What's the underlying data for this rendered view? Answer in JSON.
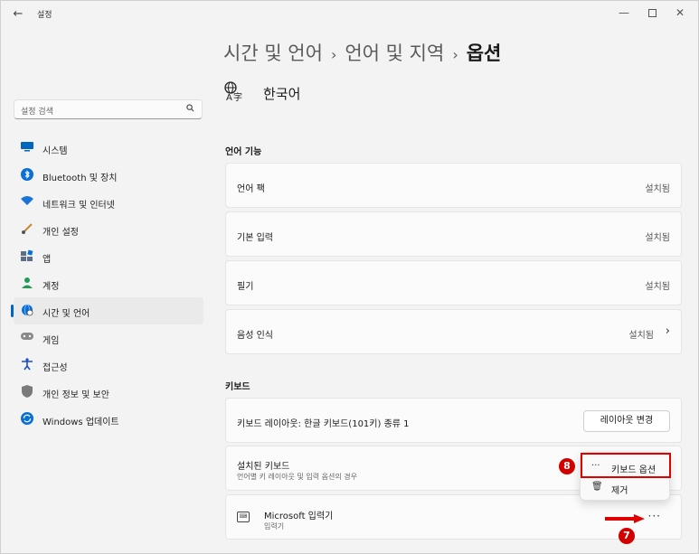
{
  "window": {
    "title": "설정",
    "back_glyph": "←",
    "min_glyph": "—",
    "close_glyph": "✕"
  },
  "search": {
    "placeholder": "설정 검색",
    "icon": "search-icon"
  },
  "nav": {
    "items": [
      {
        "label": "시스템",
        "icon": "monitor-icon",
        "color": "#0067c0"
      },
      {
        "label": "Bluetooth 및 장치",
        "icon": "bluetooth-icon",
        "color": "#0a6fd6"
      },
      {
        "label": "네트워크 및 인터넷",
        "icon": "wifi-icon",
        "color": "#1a73d6"
      },
      {
        "label": "개인 설정",
        "icon": "brush-icon",
        "color": "#c28a2e"
      },
      {
        "label": "앱",
        "icon": "apps-icon",
        "color": "#5c6f86"
      },
      {
        "label": "계정",
        "icon": "account-icon",
        "color": "#1f9d55"
      },
      {
        "label": "시간 및 언어",
        "icon": "globe-clock-icon",
        "color": "#0a6fd6"
      },
      {
        "label": "게임",
        "icon": "gamepad-icon",
        "color": "#777777"
      },
      {
        "label": "접근성",
        "icon": "accessibility-icon",
        "color": "#1a4fc7"
      },
      {
        "label": "개인 정보 및 보안",
        "icon": "shield-icon",
        "color": "#6b6b6b"
      },
      {
        "label": "Windows 업데이트",
        "icon": "update-icon",
        "color": "#0a6fd6"
      }
    ],
    "active_index": 6
  },
  "breadcrumb": {
    "part1": "시간 및 언어",
    "part2": "언어 및 지역",
    "current": "옵션",
    "sep": "›"
  },
  "language": {
    "name": "한국어",
    "icon": "language-icon"
  },
  "sections": {
    "features_title": "언어 기능",
    "keyboard_title": "키보드"
  },
  "features": [
    {
      "label": "언어 팩",
      "status": "설치됨"
    },
    {
      "label": "기본 입력",
      "status": "설치됨"
    },
    {
      "label": "필기",
      "status": "설치됨"
    },
    {
      "label": "음성 인식",
      "status": "설치됨"
    }
  ],
  "keyboard": {
    "layout_label": "키보드 레이아웃: 한글 키보드(101키) 종류 1",
    "layout_button": "레이아웃 변경",
    "installed_title": "설치된 키보드",
    "installed_sub": "언어별 키 레이아웃 및 입력 옵션의 경우",
    "ms_title": "Microsoft 입력기",
    "ms_sub": "입력기",
    "more_label": "···"
  },
  "context_menu": {
    "item1": "키보드 옵션",
    "item1_icon": "···",
    "item2": "제거",
    "item2_icon": "🗑"
  },
  "annotations": {
    "badge_top": "8",
    "badge_bottom": "7",
    "color": "#e00000"
  }
}
